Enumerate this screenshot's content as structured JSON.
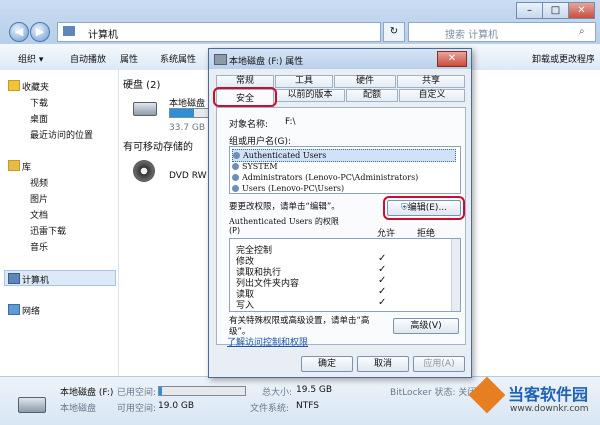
{
  "explorer": {
    "breadcrumb": [
      "计算机"
    ],
    "search_placeholder": "搜索 计算机",
    "toolbar": [
      "组织 ▾",
      "自动播放",
      "属性",
      "系统属性",
      "卸载或更改程序"
    ],
    "sidebar": [
      "收藏夹",
      "下载",
      "桌面",
      "最近访问的位置",
      "库",
      "视频",
      "图片",
      "文档",
      "迅雷下载",
      "音乐",
      "计算机",
      "网络"
    ],
    "groups": [
      {
        "title": "硬盘 (2)"
      },
      {
        "title": "有可移动存储的"
      }
    ],
    "drives": [
      {
        "name": "本地磁盘",
        "size": "33.7 GB 可"
      },
      {
        "name": "DVD RW 驱"
      }
    ]
  },
  "status": {
    "drive": "本地磁盘 (F:)",
    "type": "本地磁盘",
    "used_label": "已用空间:",
    "free_label": "可用空间:",
    "free": "19.0 GB",
    "total_label": "总大小:",
    "total": "19.5 GB",
    "fs_label": "文件系统:",
    "fs": "NTFS",
    "bitlocker": "BitLocker 状态: 关闭",
    "used_fraction": 0.03
  },
  "dialog": {
    "title": "本地磁盘 (F:) 属性",
    "tabs_row1": [
      "常规",
      "工具",
      "硬件",
      "共享"
    ],
    "tabs_row2": [
      "安全",
      "以前的版本",
      "配额",
      "自定义"
    ],
    "object_label": "对象名称:",
    "object_value": "F:\\",
    "group_label": "组或用户名(G):",
    "users": [
      "Authenticated Users",
      "SYSTEM",
      "Administrators (Lenovo-PC\\Administrators)",
      "Users (Lenovo-PC\\Users)"
    ],
    "change_text": "要更改权限，请单击“编辑”。",
    "edit_button": "编辑(E)...",
    "perm_header": "Authenticated Users 的权限",
    "perm_header_p": "(P)",
    "allow": "允许",
    "deny": "拒绝",
    "permissions": [
      {
        "name": "完全控制",
        "allow": ""
      },
      {
        "name": "修改",
        "allow": "✓"
      },
      {
        "name": "读取和执行",
        "allow": "✓"
      },
      {
        "name": "列出文件夹内容",
        "allow": "✓"
      },
      {
        "name": "读取",
        "allow": "✓"
      },
      {
        "name": "写入",
        "allow": "✓"
      }
    ],
    "advanced_text": "有关特殊权限或高级设置，请单击“高级”。",
    "advanced_button": "高级(V)",
    "learn_link": "了解访问控制和权限",
    "ok": "确定",
    "cancel": "取消",
    "apply": "应用(A)"
  },
  "watermark": {
    "brand": "当客软件园",
    "url": "www.downkr.com"
  },
  "colors": {
    "highlight": "#c8102e",
    "selection": "#cfe2f8",
    "accent": "#2e8fd6"
  }
}
